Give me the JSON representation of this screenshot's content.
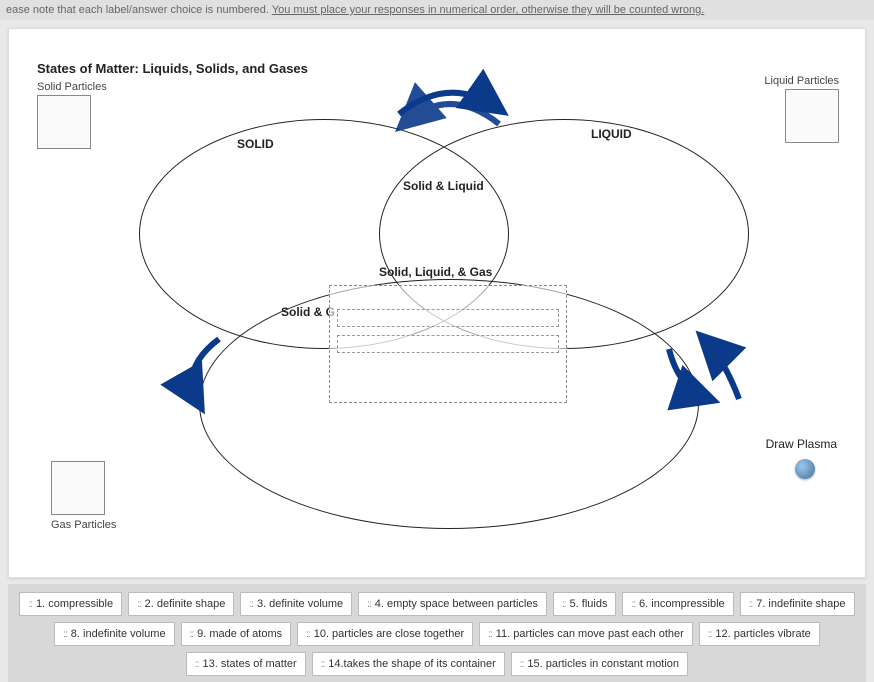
{
  "instruction": {
    "prefix": "ease note that each label/answer choice is numbered. ",
    "underlined": "You must place your responses in numerical order, otherwise they will be counted wrong."
  },
  "title": "States of Matter: Liquids, Solids, and Gases",
  "labels": {
    "solid_particles": "Solid Particles",
    "liquid_particles": "Liquid Particles",
    "gas_particles": "Gas Particles",
    "solid": "SOLID",
    "liquid": "LIQUID",
    "solid_liquid": "Solid & Liquid",
    "solid_liquid_gas": "Solid, Liquid, & Gas",
    "solid_gas_partial": "Solid & G",
    "draw_plasma": "Draw Plasma"
  },
  "choices": [
    "1. compressible",
    "2. definite shape",
    "3. definite volume",
    "4. empty space between particles",
    "5. fluids",
    "6. incompressible",
    "7. indefinite shape",
    "8. indefinite volume",
    "9. made of atoms",
    "10. particles are close together",
    "11. particles can move past each other",
    "12. particles vibrate",
    "13. states of matter",
    "14.takes the shape of its container",
    "15. particles in constant motion"
  ],
  "grip_glyph": "::"
}
